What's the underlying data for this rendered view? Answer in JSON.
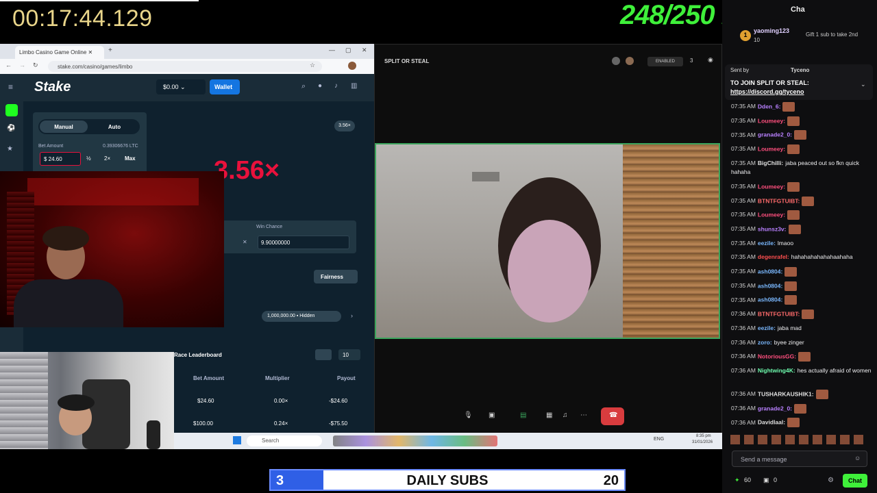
{
  "stream": {
    "timer": "00:17:44.129",
    "kick_subs": "248/250 KICK SUBS",
    "daily_subs": {
      "current": "3",
      "label": "DAILY SUBS",
      "goal": "20",
      "progress_fraction": 0.15
    }
  },
  "browser": {
    "tab_title": "Limbo Casino Game Online",
    "url": "stake.com/casino/games/limbo",
    "stake": {
      "logo": "Stake",
      "balance": "$0.00",
      "wallet_label": "Wallet",
      "mode_manual": "Manual",
      "mode_auto": "Auto",
      "bet_amount_label": "Bet Amount",
      "bet_amount_ltc": "0.39306676 LTC",
      "bet_amount_value": "$ 24.60",
      "half": "½",
      "double": "2×",
      "max": "Max",
      "multiplier_result": "3.56×",
      "recent_badge": "3.56×",
      "win_chance_label": "Win Chance",
      "win_chance_value": "9.90000000",
      "fairness": "Fairness",
      "hidden_pill": "1,000,000.00 ▪ Hidden",
      "leaderboard": "Race Leaderboard",
      "rows_select": "10",
      "table_headers": [
        "Bet Amount",
        "Multiplier",
        "Payout"
      ],
      "table_rows": [
        [
          "$24.60",
          "0.00×",
          "-$24.60"
        ],
        [
          "$100.00",
          "0.24×",
          "-$75.50"
        ]
      ]
    }
  },
  "video_call": {
    "title": "SPLIT OR STEAL",
    "enabled": "ENABLED",
    "participants": "3"
  },
  "taskbar": {
    "search": "Search",
    "lang": "ENG",
    "time": "8:35 pm",
    "date": "31/01/2026"
  },
  "chat": {
    "header": "Cha",
    "gift": {
      "user": "yaoming123",
      "count": "10",
      "badge": "1",
      "text": "Gift 1 sub to take 2nd"
    },
    "pinned": {
      "sent_by_label": "Sent by",
      "sender": "Tyceno",
      "line1": "TO JOIN SPLIT OR STEAL:",
      "line2": "https://discord.gg/tyceno"
    },
    "messages": [
      {
        "time": "07:35 AM",
        "user": "Dden_6:",
        "color": "#b980ff",
        "text": "",
        "emote": true
      },
      {
        "time": "07:35 AM",
        "user": "Loumeey:",
        "color": "#ff4f7e",
        "text": "",
        "emote": true
      },
      {
        "time": "07:35 AM",
        "user": "granade2_0:",
        "color": "#b980ff",
        "text": "",
        "emote": true
      },
      {
        "time": "07:35 AM",
        "user": "Loumeey:",
        "color": "#ff4f7e",
        "text": "",
        "emote": true
      },
      {
        "time": "07:35 AM",
        "user": "BigChilli:",
        "color": "#e0e0e0",
        "text": "jaba peaced out so fkn quick hahaha",
        "emote": false
      },
      {
        "time": "07:35 AM",
        "user": "Loumeey:",
        "color": "#ff4f7e",
        "text": "",
        "emote": true
      },
      {
        "time": "07:35 AM",
        "user": "BTNTFGTUIBT:",
        "color": "#ff6b6b",
        "text": "",
        "emote": true
      },
      {
        "time": "07:35 AM",
        "user": "Loumeey:",
        "color": "#ff4f7e",
        "text": "",
        "emote": true
      },
      {
        "time": "07:35 AM",
        "user": "shunsz3v:",
        "color": "#b980ff",
        "text": "",
        "emote": true
      },
      {
        "time": "07:35 AM",
        "user": "eezile:",
        "color": "#7ab8ff",
        "text": "lmaoo",
        "emote": false
      },
      {
        "time": "07:35 AM",
        "user": "degenrafel:",
        "color": "#ff4f4f",
        "text": "hahahahahahahaahaha",
        "emote": false
      },
      {
        "time": "07:35 AM",
        "user": "ash0804:",
        "color": "#7ab8ff",
        "text": "",
        "emote": true
      },
      {
        "time": "07:35 AM",
        "user": "ash0804:",
        "color": "#7ab8ff",
        "text": "",
        "emote": true
      },
      {
        "time": "07:35 AM",
        "user": "ash0804:",
        "color": "#7ab8ff",
        "text": "",
        "emote": true
      },
      {
        "time": "07:36 AM",
        "user": "BTNTFGTUIBT:",
        "color": "#ff6b6b",
        "text": "",
        "emote": true
      },
      {
        "time": "07:36 AM",
        "user": "eezile:",
        "color": "#7ab8ff",
        "text": "jaba mad",
        "emote": false
      },
      {
        "time": "07:36 AM",
        "user": "zoro:",
        "color": "#7ab8ff",
        "text": "byee zinger",
        "emote": false
      },
      {
        "time": "07:36 AM",
        "user": "NotoriousGG:",
        "color": "#ff4f7e",
        "text": "",
        "emote": true
      },
      {
        "time": "07:36 AM",
        "user": "Nightwing4K:",
        "color": "#6fffb0",
        "text": "hes actually afraid of women",
        "emote": false
      },
      {
        "time": "07:36 AM",
        "user": "TUSHARKAUSHIK1:",
        "color": "#e0e0e0",
        "text": "",
        "emote": true
      },
      {
        "time": "07:36 AM",
        "user": "granade2_0:",
        "color": "#b980ff",
        "text": "",
        "emote": true
      },
      {
        "time": "07:36 AM",
        "user": "Davidlaal:",
        "color": "#e0e0e0",
        "text": "",
        "emote": true
      }
    ],
    "input_placeholder": "Send a message",
    "points": "60",
    "gifts_count": "0",
    "chat_button": "Chat"
  },
  "colors": {
    "kick_green": "#3ff03a",
    "stake_bg": "#0f212e",
    "stake_blue": "#1475e1",
    "loss_red": "#e9113c",
    "discord_green": "#3ba55d"
  }
}
